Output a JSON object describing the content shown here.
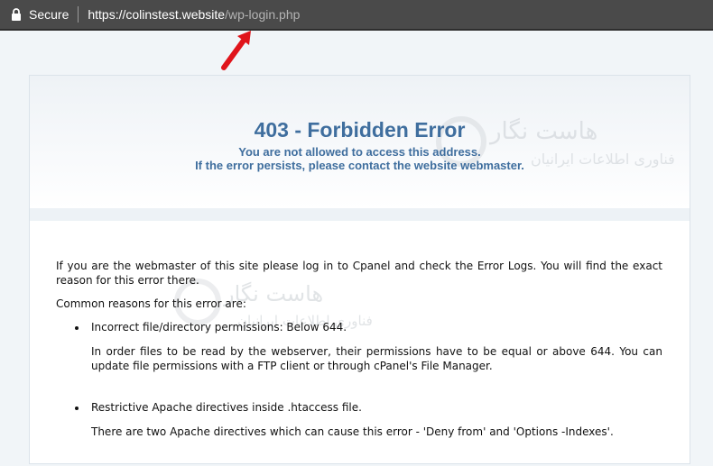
{
  "browser": {
    "secure_label": "Secure",
    "url_host": "https://colinstest.website",
    "url_path": "/wp-login.php"
  },
  "error": {
    "title": "403 - Forbidden Error",
    "line1": "You are not allowed to access this address.",
    "line2": "If the error persists, please contact the website webmaster."
  },
  "content": {
    "intro": "If you are the webmaster of this site please log in to Cpanel and check the Error Logs. You will find the exact reason for this error there.",
    "reasons_heading": "Common reasons for this error are:",
    "reasons": [
      {
        "title": "Incorrect file/directory permissions: Below 644.",
        "detail": "In order files to be read by the webserver, their permissions have to be equal or above 644. You can update file permissions with a FTP client or through cPanel's File Manager."
      },
      {
        "title": "Restrictive Apache directives inside .htaccess file.",
        "detail": "There are two Apache directives which can cause this error - 'Deny from' and 'Options -Indexes'."
      }
    ]
  },
  "watermark": {
    "name": "هاست نگار",
    "tagline": "فناوری اطلاعات ایرانیان"
  },
  "colors": {
    "title_blue": "#3f6e9e",
    "arrow_red": "#e0141b",
    "addressbar_bg": "#4a4a4a"
  },
  "icons": [
    "lock-icon",
    "annotation-arrow-icon",
    "bullet-icon"
  ]
}
